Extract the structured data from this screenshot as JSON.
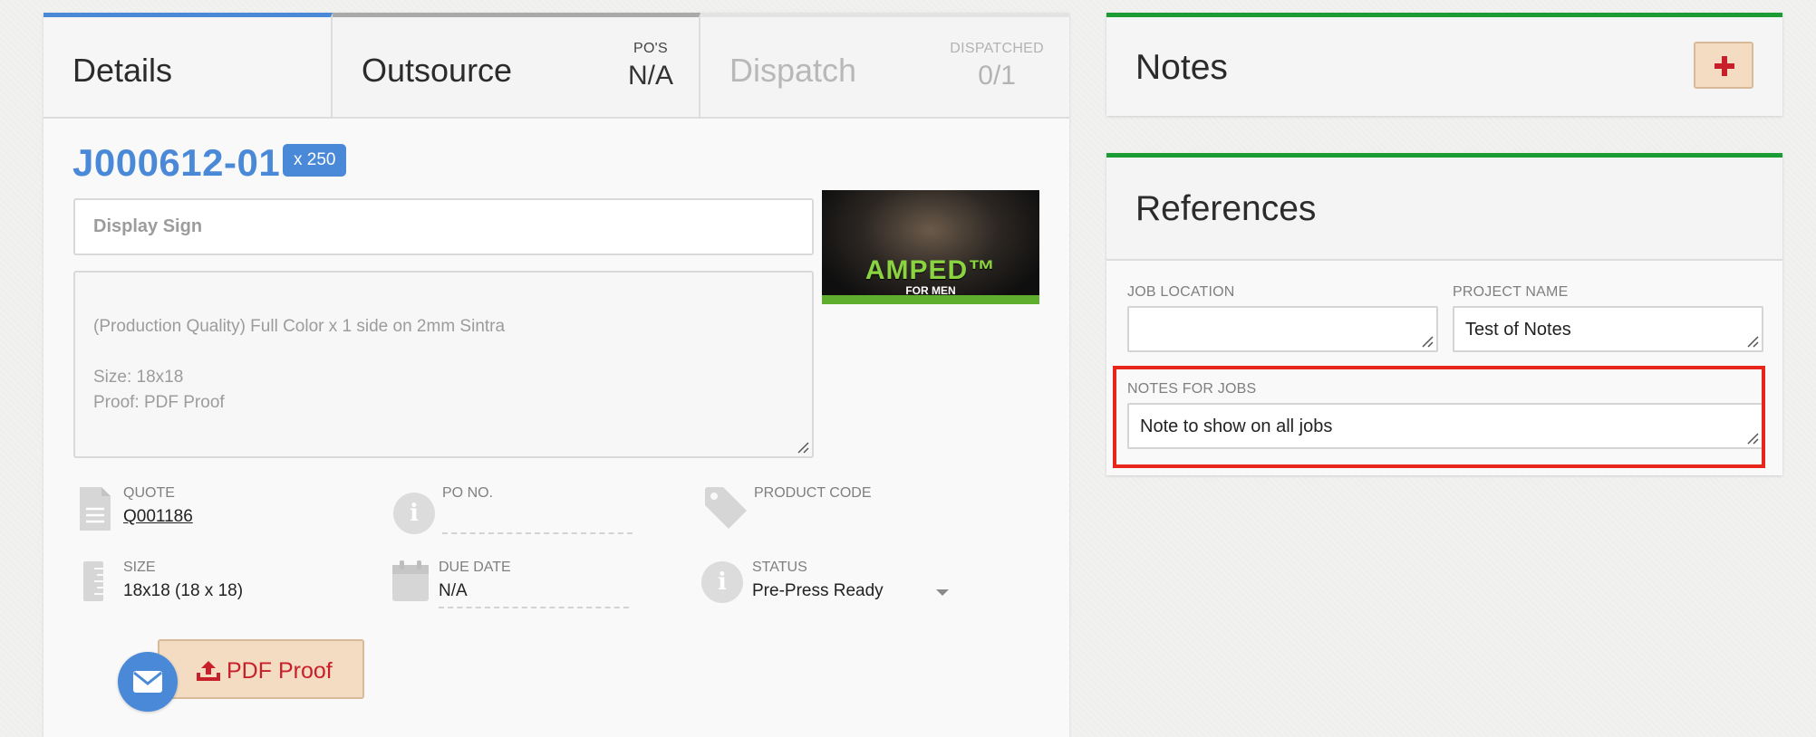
{
  "tabs": {
    "details": {
      "label": "Details"
    },
    "outsource": {
      "label": "Outsource",
      "meta_label": "PO'S",
      "meta_value": "N/A"
    },
    "dispatch": {
      "label": "Dispatch",
      "meta_label": "DISPATCHED",
      "meta_value": "0/1"
    }
  },
  "job": {
    "id": "J000612-01",
    "quantity": "x 250",
    "title_value": "Display Sign",
    "description": "(Production Quality) Full Color x 1 side  on 2mm Sintra\n\nSize: 18x18\nProof:  PDF Proof"
  },
  "thumbnail": {
    "headline": "AMPED™",
    "subline": "FOR MEN"
  },
  "info": {
    "quote_label": "QUOTE",
    "quote_value": "Q001186",
    "po_label": "PO NO.",
    "po_value": "",
    "product_code_label": "PRODUCT CODE",
    "size_label": "SIZE",
    "size_value": "18x18 (18 x 18)",
    "due_label": "DUE DATE",
    "due_value": "N/A",
    "status_label": "STATUS",
    "status_value": "Pre-Press Ready"
  },
  "actions": {
    "proof_label": "PDF Proof"
  },
  "notes": {
    "title": "Notes"
  },
  "references": {
    "title": "References",
    "job_location_label": "JOB LOCATION",
    "job_location_value": "",
    "project_name_label": "PROJECT NAME",
    "project_name_value": "Test of Notes",
    "notes_for_jobs_label": "NOTES FOR JOBS",
    "notes_for_jobs_value": "Note to show on all jobs"
  },
  "colors": {
    "accent_blue": "#4a89d8",
    "accent_green": "#1a9b34",
    "button_bg": "#f4dcc3",
    "button_text": "#c8202b",
    "highlight": "#e8261b"
  },
  "icons": [
    "document-icon",
    "info-icon",
    "tag-icon",
    "ruler-icon",
    "calendar-icon",
    "chevron-down-icon",
    "upload-icon",
    "envelope-icon",
    "plus-icon",
    "resize-grip-icon"
  ]
}
